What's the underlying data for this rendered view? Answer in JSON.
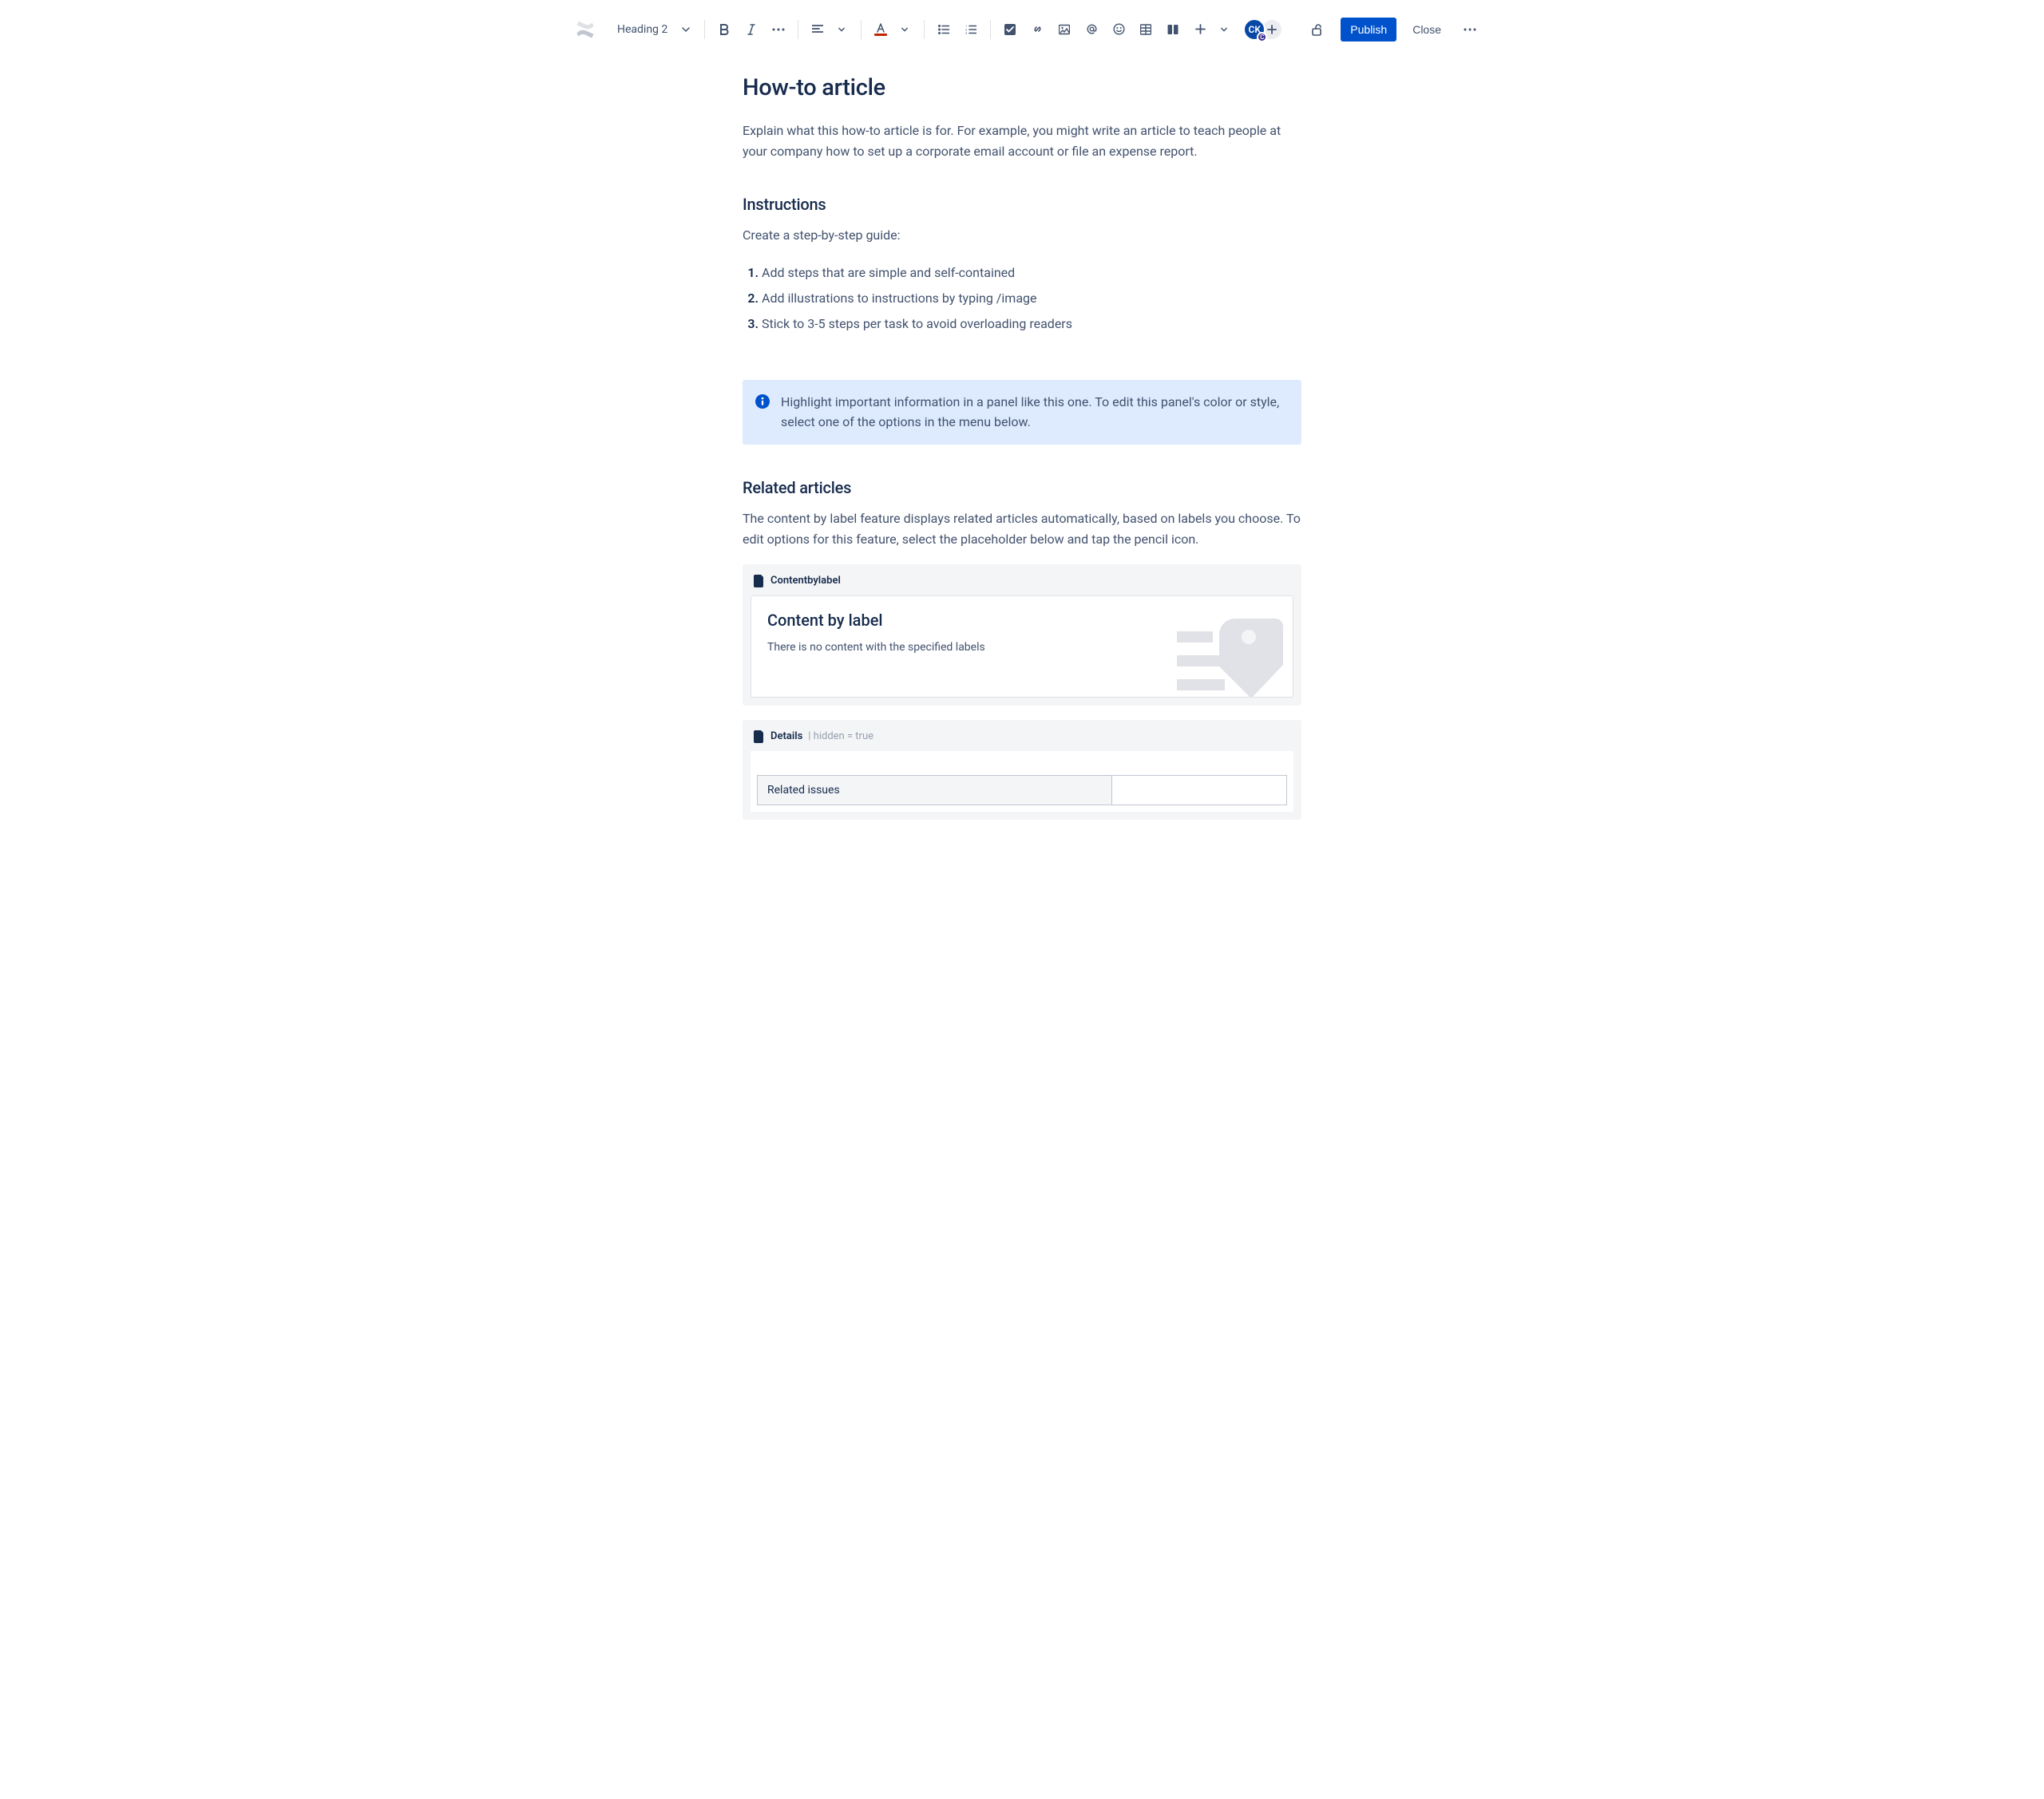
{
  "toolbar": {
    "text_style": "Heading 2",
    "text_color_underline": "#BF2600",
    "publish_label": "Publish",
    "close_label": "Close"
  },
  "presence": {
    "avatar_initials": "CK",
    "avatar_badge": "C"
  },
  "page": {
    "title": "How-to article",
    "intro": "Explain what this how-to article is for. For example, you might write an article to teach people at your company how to set up a corporate email account or file an expense report.",
    "instructions_heading": "Instructions",
    "instructions_lead": "Create a step-by-step guide:",
    "steps": [
      "Add steps that are simple and self-contained",
      "Add illustrations to instructions by typing /image",
      "Stick to 3-5 steps per task to avoid overloading readers"
    ],
    "info_panel": "Highlight important information in a panel like this one. To edit this panel's color or style, select one of the options in the menu below.",
    "related_heading": "Related articles",
    "related_lead": "The content by label feature displays related articles automatically, based on labels you choose. To edit options for this feature, select the placeholder below and tap the pencil icon."
  },
  "macros": {
    "content_by_label": {
      "header": "Contentbylabel",
      "title": "Content by label",
      "empty_message": "There is no content with the specified labels"
    },
    "details": {
      "header": "Details",
      "params": " | hidden = true",
      "row_label": "Related issues"
    }
  }
}
